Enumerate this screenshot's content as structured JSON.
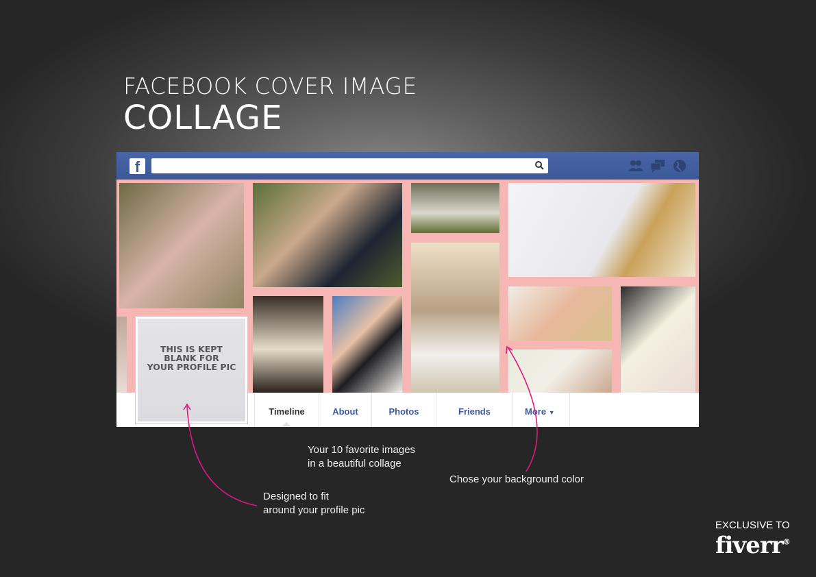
{
  "heading": {
    "line1": "FACEBOOK COVER IMAGE",
    "line2": "COLLAGE"
  },
  "facebook": {
    "logo": "f",
    "search_placeholder": "",
    "header_icons": [
      "friends-icon",
      "messages-icon",
      "globe-icon"
    ],
    "colors": {
      "brand": "#3b5998",
      "collage_border": "#f6b7b4"
    },
    "profile_placeholder": [
      "THIS IS KEPT",
      "BLANK FOR",
      "YOUR PROFILE PIC"
    ],
    "tabs": [
      {
        "label": "Timeline",
        "active": true
      },
      {
        "label": "About"
      },
      {
        "label": "Photos"
      },
      {
        "label": "Friends"
      },
      {
        "label": "More",
        "dropdown": true
      }
    ],
    "photos": [
      "bridesmaids",
      "musicians",
      "couple-on-lawn",
      "wedding-rings-wedding-day",
      "couple-entering-hall",
      "couple-kissing-veil",
      "sunset-kiss",
      "heart-shoes",
      "bouquet-bride",
      "groom-bride-bouquet"
    ]
  },
  "captions": {
    "images": [
      "Your 10 favorite images",
      "in a beautiful collage"
    ],
    "profile": [
      "Designed to fit",
      "around your profile pic"
    ],
    "background": "Chose your background color"
  },
  "badge": {
    "label": "EXCLUSIVE TO",
    "brand": "fiverr",
    "reg": "®"
  }
}
